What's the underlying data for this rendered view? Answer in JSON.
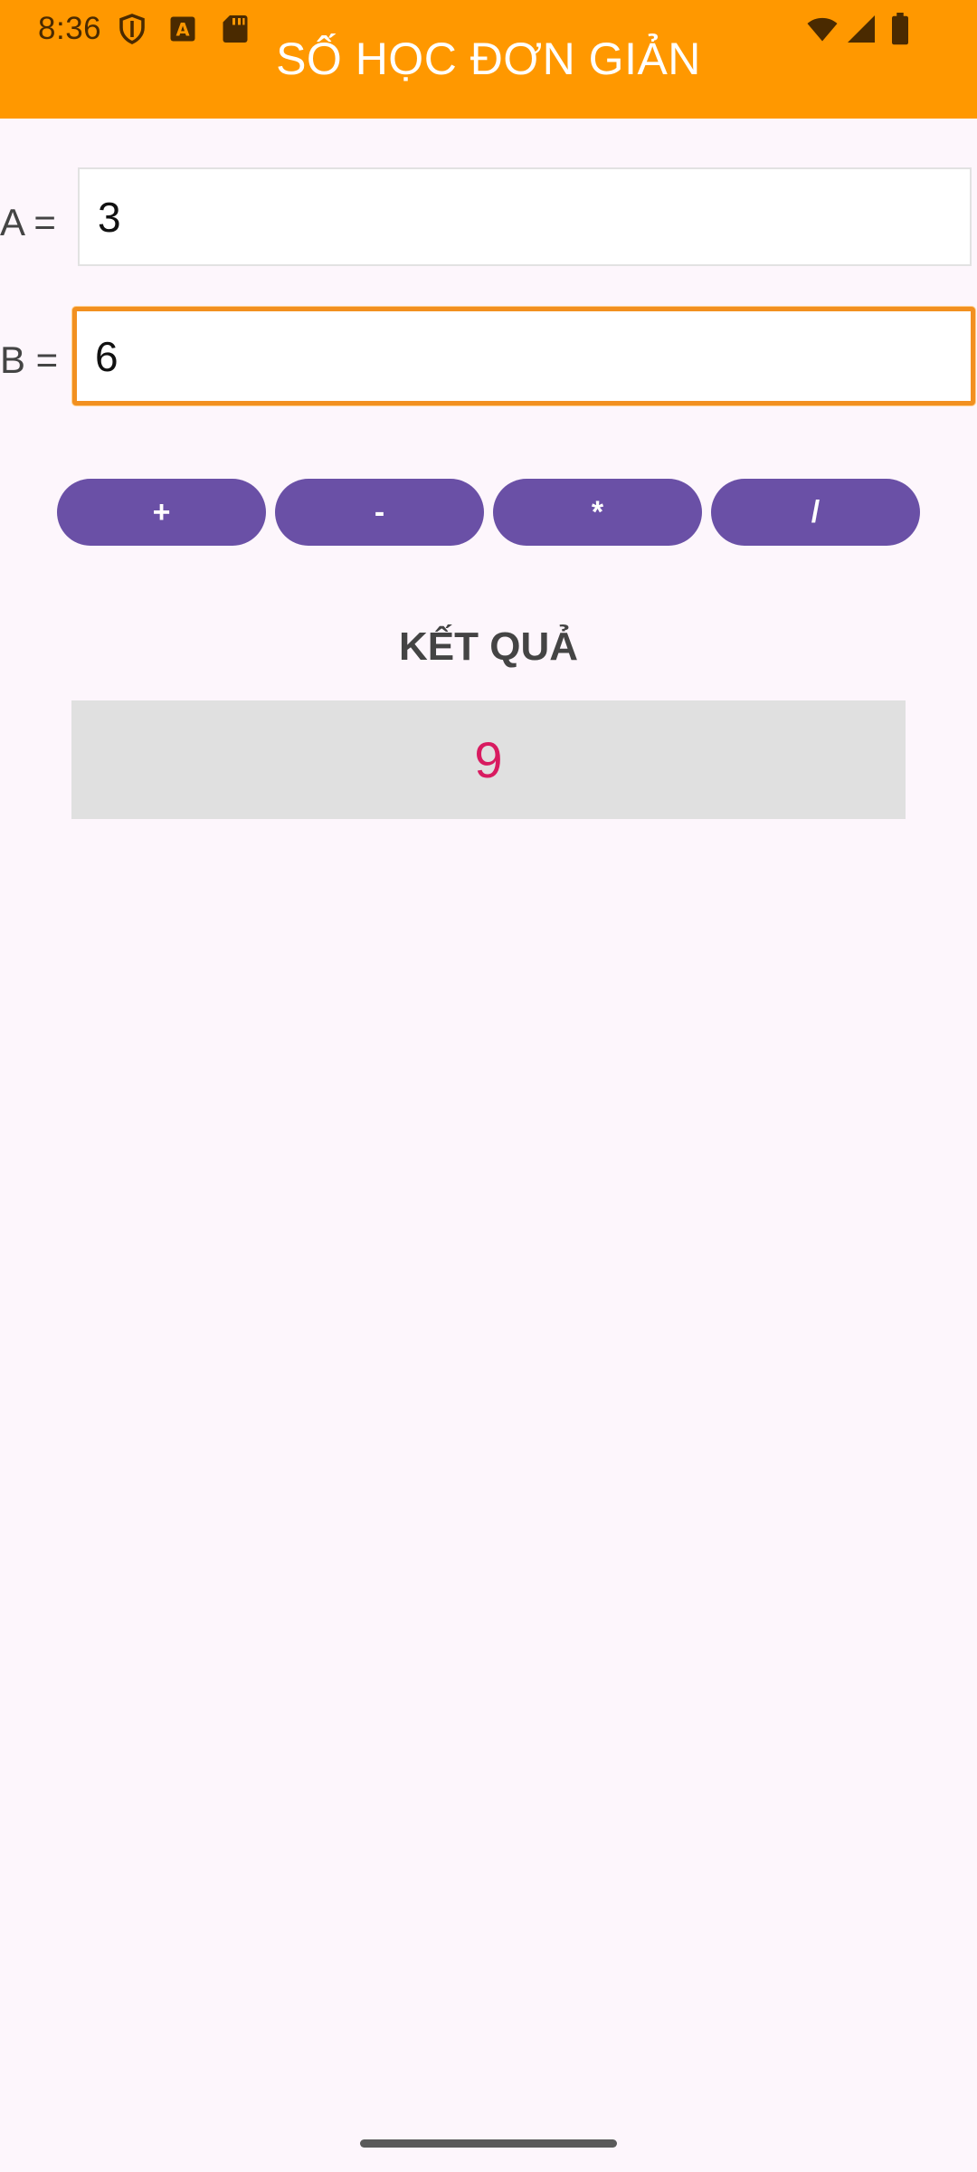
{
  "status_bar": {
    "time": "8:36",
    "left_icons": [
      "shield-icon",
      "font-a-icon",
      "sd-card-icon"
    ],
    "right_icons": [
      "wifi-icon",
      "cell-signal-icon",
      "battery-icon"
    ]
  },
  "header": {
    "title": "SỐ HỌC ĐƠN GIẢN",
    "color": "#ff9800"
  },
  "inputs": {
    "a": {
      "label": "A =",
      "value": "3"
    },
    "b": {
      "label": "B =",
      "value": "6",
      "focused": true
    }
  },
  "operations": [
    {
      "label": "+"
    },
    {
      "label": "-"
    },
    {
      "label": "*"
    },
    {
      "label": "/"
    }
  ],
  "result": {
    "title": "KẾT QUẢ",
    "value": "9",
    "value_color": "#d81b60"
  },
  "colors": {
    "accent": "#ff9800",
    "button": "#6a50a6",
    "background": "#fdf6fc"
  }
}
